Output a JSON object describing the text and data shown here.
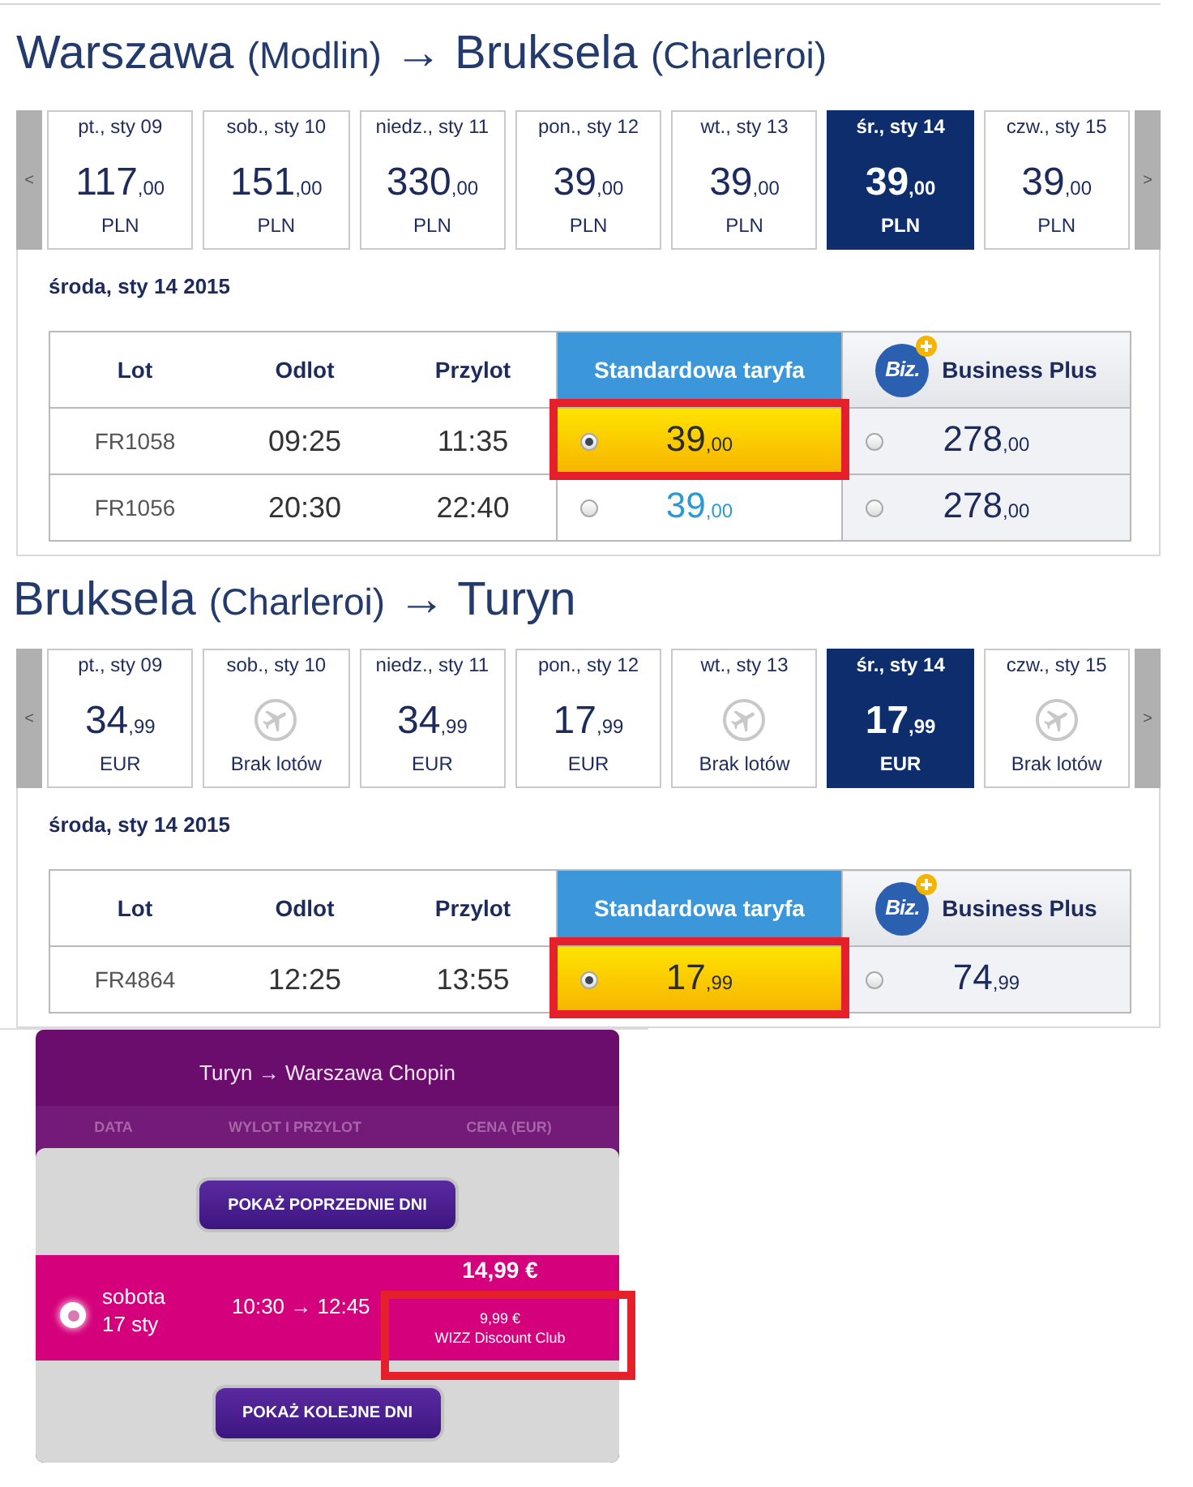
{
  "segments": [
    {
      "title": {
        "origin": "Warszawa",
        "origin_airport": "(Modlin)",
        "arrow": "→",
        "destination": "Bruksela",
        "destination_airport": "(Charleroi)"
      },
      "strip": {
        "prev": "<",
        "next": ">",
        "days": [
          {
            "label": "pt., sty 09",
            "kind": "fare",
            "amount": "117",
            "fraction": ",00",
            "currency": "PLN",
            "selected": false
          },
          {
            "label": "sob., sty 10",
            "kind": "fare",
            "amount": "151",
            "fraction": ",00",
            "currency": "PLN",
            "selected": false
          },
          {
            "label": "niedz., sty 11",
            "kind": "fare",
            "amount": "330",
            "fraction": ",00",
            "currency": "PLN",
            "selected": false
          },
          {
            "label": "pon., sty 12",
            "kind": "fare",
            "amount": "39",
            "fraction": ",00",
            "currency": "PLN",
            "selected": false
          },
          {
            "label": "wt., sty 13",
            "kind": "fare",
            "amount": "39",
            "fraction": ",00",
            "currency": "PLN",
            "selected": false
          },
          {
            "label": "śr., sty 14",
            "kind": "fare",
            "amount": "39",
            "fraction": ",00",
            "currency": "PLN",
            "selected": true
          },
          {
            "label": "czw., sty 15",
            "kind": "fare",
            "amount": "39",
            "fraction": ",00",
            "currency": "PLN",
            "selected": false
          }
        ]
      },
      "date": "środa, sty 14 2015",
      "columns": [
        {
          "label": "Lot",
          "kind": "plain"
        },
        {
          "label": "Odlot",
          "kind": "plain"
        },
        {
          "label": "Przylot",
          "kind": "plain"
        },
        {
          "label": "Standardowa taryfa",
          "kind": "standard"
        },
        {
          "label": "Business Plus",
          "kind": "business",
          "logo": "Biz."
        }
      ],
      "rows": [
        {
          "flight": "FR1058",
          "departure": "09:25",
          "arrival": "11:35",
          "fares": [
            {
              "amount": "39",
              "fraction": ",00",
              "selected": true,
              "highlighted": true
            },
            {
              "amount": "278",
              "fraction": ",00",
              "selected": false,
              "highlighted": false
            }
          ]
        },
        {
          "flight": "FR1056",
          "departure": "20:30",
          "arrival": "22:40",
          "fares": [
            {
              "amount": "39",
              "fraction": ",00",
              "selected": false,
              "highlighted": false
            },
            {
              "amount": "278",
              "fraction": ",00",
              "selected": false,
              "highlighted": false
            }
          ]
        }
      ]
    },
    {
      "title": {
        "origin": "Bruksela",
        "origin_airport": "(Charleroi)",
        "arrow": "→",
        "destination": "Turyn"
      },
      "strip": {
        "prev": "<",
        "next": ">",
        "days": [
          {
            "label": "pt., sty 09",
            "kind": "fare",
            "amount": "34",
            "fraction": ",99",
            "currency": "EUR",
            "selected": false
          },
          {
            "label": "sob., sty 10",
            "kind": "none",
            "text": "Brak lotów",
            "selected": false
          },
          {
            "label": "niedz., sty 11",
            "kind": "fare",
            "amount": "34",
            "fraction": ",99",
            "currency": "EUR",
            "selected": false
          },
          {
            "label": "pon., sty 12",
            "kind": "fare",
            "amount": "17",
            "fraction": ",99",
            "currency": "EUR",
            "selected": false
          },
          {
            "label": "wt., sty 13",
            "kind": "none",
            "text": "Brak lotów",
            "selected": false
          },
          {
            "label": "śr., sty 14",
            "kind": "fare",
            "amount": "17",
            "fraction": ",99",
            "currency": "EUR",
            "selected": true
          },
          {
            "label": "czw., sty 15",
            "kind": "none",
            "text": "Brak lotów",
            "selected": false
          }
        ]
      },
      "date": "środa, sty 14 2015",
      "columns": [
        {
          "label": "Lot",
          "kind": "plain"
        },
        {
          "label": "Odlot",
          "kind": "plain"
        },
        {
          "label": "Przylot",
          "kind": "plain"
        },
        {
          "label": "Standardowa taryfa",
          "kind": "standard"
        },
        {
          "label": "Business Plus",
          "kind": "business",
          "logo": "Biz."
        }
      ],
      "rows": [
        {
          "flight": "FR4864",
          "departure": "12:25",
          "arrival": "13:55",
          "fares": [
            {
              "amount": "17",
              "fraction": ",99",
              "selected": true,
              "highlighted": true
            },
            {
              "amount": "74",
              "fraction": ",99",
              "selected": false,
              "highlighted": false
            }
          ]
        }
      ]
    }
  ],
  "wizz": {
    "title": "Turyn → Warszawa Chopin",
    "columns": [
      "DATA",
      "WYLOT I PRZYLOT",
      "CENA (EUR)"
    ],
    "prev_button": "POKAŻ POPRZEDNIE DNI",
    "flights": [
      {
        "weekday": "sobota",
        "date": "17 sty",
        "times": "10:30 → 12:45",
        "price": "14,99 €",
        "discount_price": "9,99 €",
        "discount_label": "WIZZ Discount Club",
        "selected": true,
        "highlighted": true
      }
    ],
    "next_button": "POKAŻ KOLEJNE DNI"
  }
}
